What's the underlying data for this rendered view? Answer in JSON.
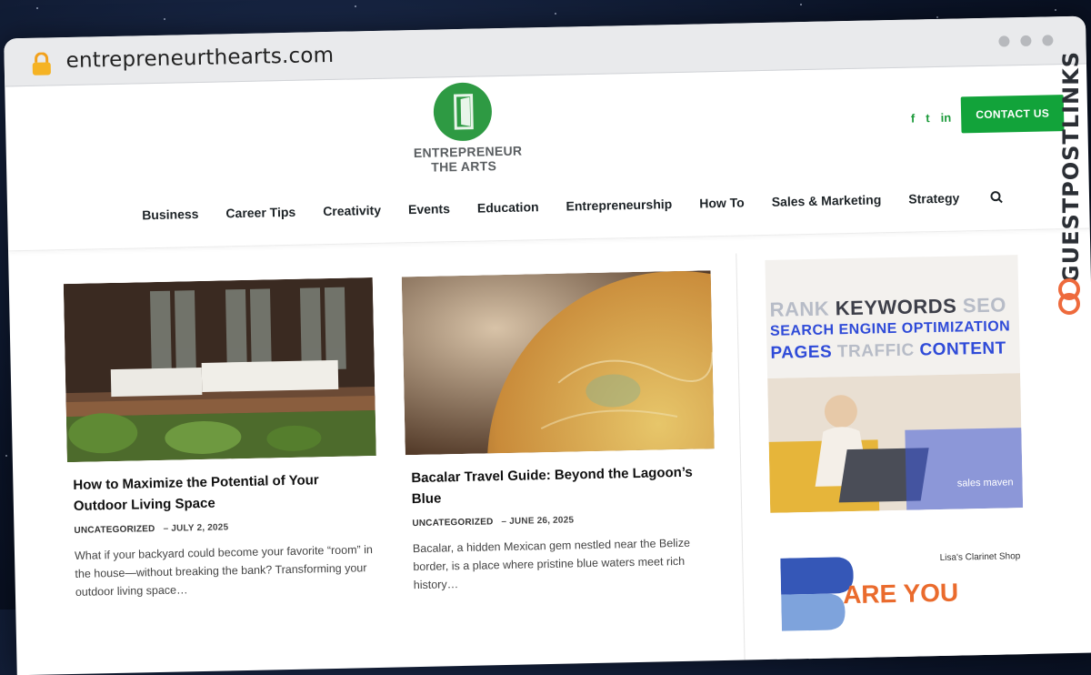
{
  "browser": {
    "url": "entrepreneurthearts.com",
    "icons": {
      "lock": "lock-icon"
    }
  },
  "site": {
    "logo": {
      "line1": "ENTREPRENEUR",
      "line2": "THE ARTS"
    },
    "social": [
      {
        "name": "facebook-icon",
        "glyph": "f"
      },
      {
        "name": "twitter-icon",
        "glyph": "t"
      },
      {
        "name": "linkedin-icon",
        "glyph": "in"
      }
    ],
    "contact_label": "CONTACT US",
    "nav": [
      "Business",
      "Career Tips",
      "Creativity",
      "Events",
      "Education",
      "Entrepreneurship",
      "How To",
      "Sales & Marketing",
      "Strategy"
    ],
    "accent": "#12a33a"
  },
  "posts": [
    {
      "title": "How to Maximize the Potential of Your Outdoor Living Space",
      "category": "UNCATEGORIZED",
      "date": "JULY 2, 2025",
      "excerpt": "What if your backyard could become your favorite “room” in the house—without breaking the bank? Transforming your outdoor living space…"
    },
    {
      "title": "Bacalar Travel Guide: Beyond the Lagoon’s Blue",
      "category": "UNCATEGORIZED",
      "date": "JUNE 26, 2025",
      "excerpt": "Bacalar, a hidden Mexican gem nestled near the Belize border, is a place where pristine blue waters meet rich history…"
    }
  ],
  "ads": {
    "seo": {
      "rank": "RANK",
      "keywords": "KEYWORDS",
      "seo": "SEO",
      "line2": "SEARCH ENGINE OPTIMIZATION",
      "pages": "PAGES",
      "traffic": "TRAFFIC",
      "content": "CONTENT",
      "brand": "sales maven"
    },
    "clarinet": {
      "shop": "Lisa's Clarinet Shop",
      "headline": "ARE YOU"
    }
  },
  "watermark": "GUESTPOSTLINKS"
}
